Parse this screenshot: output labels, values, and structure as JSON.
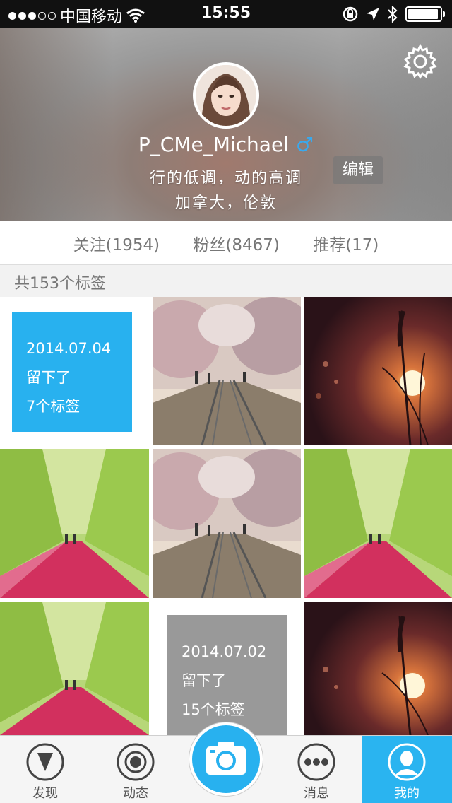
{
  "status_bar": {
    "carrier": "中国移动",
    "time": "15:55",
    "signal_dots": 5,
    "signal_filled": 3,
    "battery_percent": 95
  },
  "header": {
    "username": "P_CMe_Michael",
    "gender_symbol": "♂",
    "bio_line1": "行的低调，动的高调",
    "bio_line2": "加拿大，伦敦",
    "edit_label": "编辑"
  },
  "stats": {
    "following": "关注(1954)",
    "followers": "粉丝(8467)",
    "recommend": "推荐(17)"
  },
  "tag_summary": "共153个标签",
  "cards": {
    "blue": {
      "date": "2014.07.04",
      "line2": "留下了",
      "line3": "7个标签"
    },
    "gray": {
      "date": "2014.07.02",
      "line2": "留下了",
      "line3": "15个标签"
    }
  },
  "tabs": {
    "discover": "发现",
    "feed": "动态",
    "messages": "消息",
    "me": "我的"
  },
  "colors": {
    "accent": "#28b1ef",
    "gray_card": "#999999"
  }
}
